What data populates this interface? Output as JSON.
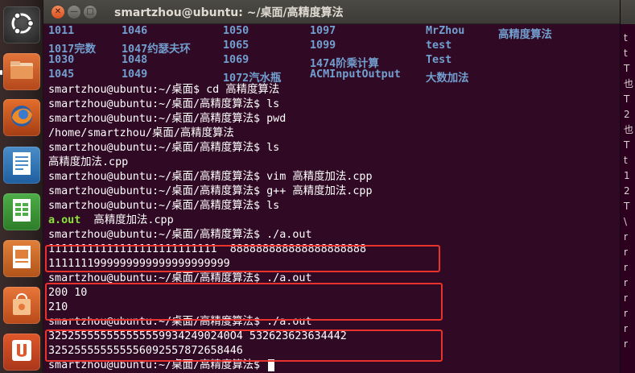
{
  "window": {
    "title": "smartzhou@ubuntu: ~/桌面/高精度算法",
    "close_glyph": "✕",
    "min_glyph": "—",
    "max_glyph": "□"
  },
  "launcher": {
    "items": [
      {
        "name": "dash-home",
        "icon": "ubuntu-logo-icon"
      },
      {
        "name": "home-folder",
        "icon": "folder-icon"
      },
      {
        "name": "firefox",
        "icon": "firefox-icon"
      },
      {
        "name": "libreoffice-writer",
        "icon": "writer-icon"
      },
      {
        "name": "libreoffice-calc",
        "icon": "calc-icon"
      },
      {
        "name": "libreoffice-impress",
        "icon": "impress-icon"
      },
      {
        "name": "ubuntu-software-center",
        "icon": "shopping-bag-icon"
      },
      {
        "name": "ubuntu-one",
        "icon": "ubuntu-one-icon"
      }
    ]
  },
  "listing": {
    "rows": [
      [
        "1011",
        "1046",
        "1050",
        "1097",
        "MrZhou",
        "高精度算法"
      ],
      [
        "1017完数",
        "1047约瑟夫环",
        "1065",
        "1099",
        "test",
        ""
      ],
      [
        "1030",
        "1048",
        "1069",
        "1474阶乘计算",
        "Test",
        ""
      ],
      [
        "1045",
        "1049",
        "1072汽水瓶",
        "ACMInputOutput",
        "大数加法",
        ""
      ]
    ]
  },
  "terminal": {
    "lines": [
      "smartzhou@ubuntu:~/桌面$ cd 高精度算法",
      "smartzhou@ubuntu:~/桌面/高精度算法$ ls",
      "smartzhou@ubuntu:~/桌面/高精度算法$ pwd",
      "/home/smartzhou/桌面/高精度算法",
      "smartzhou@ubuntu:~/桌面/高精度算法$ ls",
      "高精度加法.cpp",
      "smartzhou@ubuntu:~/桌面/高精度算法$ vim 高精度加法.cpp",
      "smartzhou@ubuntu:~/桌面/高精度算法$ g++ 高精度加法.cpp",
      "smartzhou@ubuntu:~/桌面/高精度算法$ ls"
    ],
    "ls_exe": "a.out",
    "ls_src": "  高精度加法.cpp",
    "run_lines": [
      "smartzhou@ubuntu:~/桌面/高精度算法$ ./a.out",
      "11111111111111111111111111  888888888888888888888",
      "1111111999999999999999999999",
      "smartzhou@ubuntu:~/桌面/高精度算法$ ./a.out",
      "200 10",
      "210",
      "smartzhou@ubuntu:~/桌面/高精度算法$ ./a.out",
      "3252555555555555599342490240O4 532623623634442",
      "325255555555556092557872658446",
      "smartzhou@ubuntu:~/桌面/高精度算法$ "
    ]
  },
  "background_window": {
    "fragments": [
      "t",
      "t",
      "T",
      "也",
      "T",
      "2",
      "也",
      "T",
      "t",
      "1",
      "2",
      "T",
      "\\",
      "r",
      "r",
      "r",
      "r",
      "r",
      "r",
      "r",
      "r"
    ]
  },
  "colors": {
    "terminal_bg": "#300a24",
    "directory": "#729fcf",
    "executable": "#8ae234",
    "annotation": "#e8332c"
  }
}
